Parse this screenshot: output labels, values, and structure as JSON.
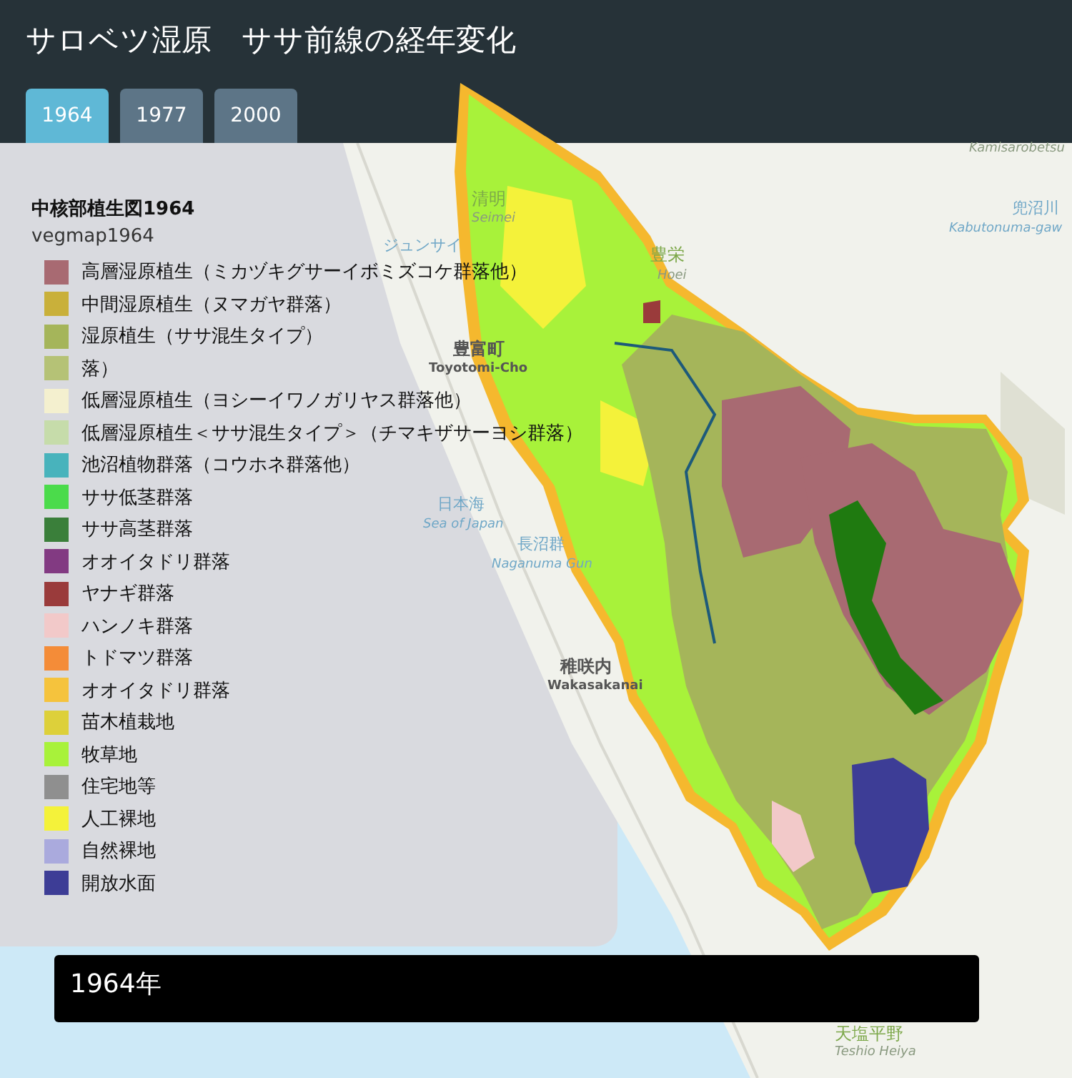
{
  "title": "サロベツ湿原　ササ前線の経年変化",
  "tabs": [
    {
      "label": "1964",
      "selected": true
    },
    {
      "label": "1977",
      "selected": false
    },
    {
      "label": "2000",
      "selected": false
    }
  ],
  "legend": {
    "title": "中核部植生図1964",
    "layer": "vegmap1964",
    "items": [
      {
        "label": "高層湿原植生（ミカヅキグサーイボミズコケ群落他）",
        "color": "#a86a72"
      },
      {
        "label": "中間湿原植生（ヌマガヤ群落）",
        "color": "#c9b03a"
      },
      {
        "label": "湿原植生（ササ混生タイプ）",
        "color": "#a5b55a"
      },
      {
        "label": "落）",
        "color": "#b5c276"
      },
      {
        "label": "低層湿原植生（ヨシーイワノガリヤス群落他）",
        "color": "#f4f0cf"
      },
      {
        "label": "低層湿原植生＜ササ混生タイプ＞（チマキザサーヨシ群落）",
        "color": "#c6dcaa"
      },
      {
        "label": "池沼植物群落（コウホネ群落他）",
        "color": "#48b3bc"
      },
      {
        "label": "ササ低茎群落",
        "color": "#4bdb4b"
      },
      {
        "label": "ササ高茎群落",
        "color": "#3a7f3a"
      },
      {
        "label": "オオイタドリ群落",
        "color": "#823a82"
      },
      {
        "label": "ヤナギ群落",
        "color": "#9a3b3b"
      },
      {
        "label": "ハンノキ群落",
        "color": "#f2c9c9"
      },
      {
        "label": "トドマツ群落",
        "color": "#f48c38"
      },
      {
        "label": "オオイタドリ群落",
        "color": "#f5c33d"
      },
      {
        "label": "苗木植栽地",
        "color": "#ddd03a"
      },
      {
        "label": "牧草地",
        "color": "#a8f23a"
      },
      {
        "label": "住宅地等",
        "color": "#8f8f8f"
      },
      {
        "label": "人工裸地",
        "color": "#f4f23a"
      },
      {
        "label": "自然裸地",
        "color": "#aaaadd"
      },
      {
        "label": "開放水面",
        "color": "#3d3d96"
      }
    ]
  },
  "map_labels": [
    "清明",
    "Seimei",
    "ジュンサイ",
    "豊栄",
    "Hoei",
    "豊富町",
    "Toyotomi-Cho",
    "日本海",
    "Sea of Japan",
    "長沼群",
    "Naganuma Gun",
    "稚咲内",
    "Wakasakanai",
    "Kamisarobetsu",
    "兜沼川",
    "Kabutonuma-gaw",
    "天塩平野",
    "Teshio Heiya"
  ],
  "caption": "1964年"
}
